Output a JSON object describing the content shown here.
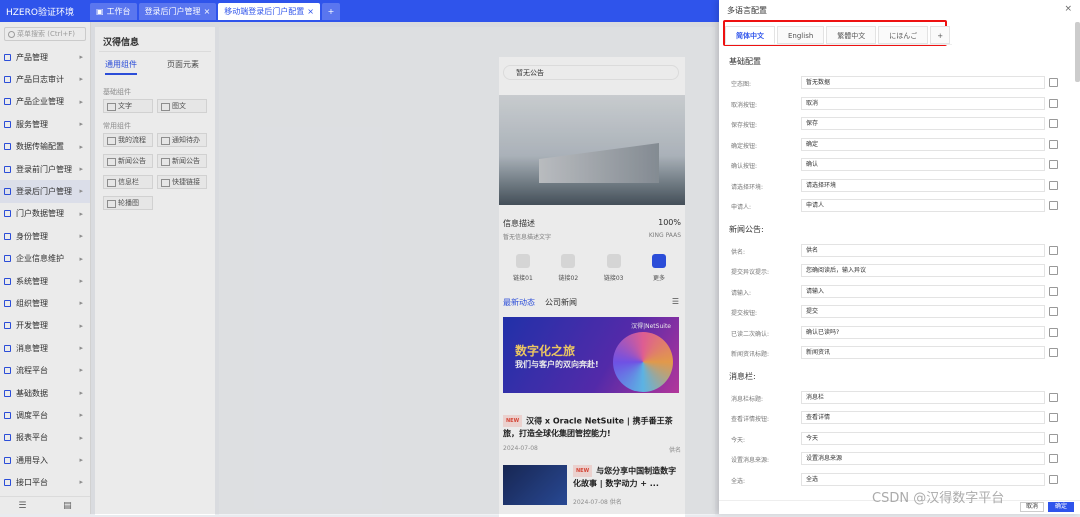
{
  "app": {
    "title": "HZERO验证环境"
  },
  "tabs": [
    {
      "label": "工作台",
      "active": false,
      "closable": false
    },
    {
      "label": "登录后门户管理",
      "active": false,
      "closable": true
    },
    {
      "label": "移动端登录后门户配置",
      "active": true,
      "closable": true
    }
  ],
  "sidebar": {
    "search_placeholder": "菜单搜索 (Ctrl+F)",
    "items": [
      {
        "label": "产品管理"
      },
      {
        "label": "产品日志审计"
      },
      {
        "label": "产品企业管理"
      },
      {
        "label": "服务管理"
      },
      {
        "label": "数据传输配置"
      },
      {
        "label": "登录前门户管理"
      },
      {
        "label": "登录后门户管理",
        "active": true
      },
      {
        "label": "门户数据管理"
      },
      {
        "label": "身份管理"
      },
      {
        "label": "企业信息维护"
      },
      {
        "label": "系统管理"
      },
      {
        "label": "组织管理"
      },
      {
        "label": "开发管理"
      },
      {
        "label": "消息管理"
      },
      {
        "label": "流程平台"
      },
      {
        "label": "基础数据"
      },
      {
        "label": "调度平台"
      },
      {
        "label": "报表平台"
      },
      {
        "label": "通用导入"
      },
      {
        "label": "接口平台"
      }
    ]
  },
  "editor": {
    "title": "汉得信息",
    "tabs": [
      {
        "label": "通用组件",
        "active": true
      },
      {
        "label": "页面元素",
        "active": false
      }
    ],
    "group_basic": "基础组件",
    "basic": [
      {
        "label": "文字"
      },
      {
        "label": "图文"
      }
    ],
    "group_common": "常用组件",
    "common": [
      {
        "label": "我的流程"
      },
      {
        "label": "通知待办"
      },
      {
        "label": "新闻公告"
      },
      {
        "label": "新闻公告"
      },
      {
        "label": "信息栏"
      },
      {
        "label": "快捷链接"
      },
      {
        "label": "轮播图"
      }
    ]
  },
  "preview": {
    "notice": "暂无公告",
    "info_title": "信息描述",
    "info_pct": "100%",
    "info_sub": "暂无信息描述文字",
    "info_brand": "KING PAAS",
    "links": [
      {
        "label": "链接01"
      },
      {
        "label": "链接02"
      },
      {
        "label": "链接03"
      },
      {
        "label": "更多"
      }
    ],
    "news_tabs": [
      {
        "label": "最新动态",
        "active": true
      },
      {
        "label": "公司新闻",
        "active": false
      }
    ],
    "promo_line1": "数字化之旅",
    "promo_line2": "我们与客户的双向奔赴!",
    "promo_logo": "汉得|NetSuite",
    "badge": "NEW",
    "news1_title": "汉得 x Oracle NetSuite | 携手番王茶旅，打造全球化集团管控能力!",
    "news1_date": "2024-07-08",
    "news1_author": "供名",
    "news2_title": "与您分享中国制造数字化故事 | 数字动力 + ...",
    "news2_date": "2024-07-08",
    "news2_author": "供名"
  },
  "drawer": {
    "title": "多语言配置",
    "close": "×",
    "lang_tabs": [
      {
        "label": "简体中文",
        "active": true
      },
      {
        "label": "English"
      },
      {
        "label": "繁體中文"
      },
      {
        "label": "にほんご"
      }
    ],
    "sections": [
      {
        "title": "基础配置",
        "rows": [
          {
            "label": "空态图:",
            "value": "暂无数据"
          },
          {
            "label": "取消按钮:",
            "value": "取消"
          },
          {
            "label": "保存按钮:",
            "value": "保存"
          },
          {
            "label": "确定按钮:",
            "value": "确定"
          },
          {
            "label": "确认按钮:",
            "value": "确认"
          },
          {
            "label": "请选择环境:",
            "value": "请选择环境"
          },
          {
            "label": "申请人:",
            "value": "申请人"
          }
        ]
      },
      {
        "title": "新闻公告:",
        "rows": [
          {
            "label": "供名:",
            "value": "供名"
          },
          {
            "label": "提交异议提示:",
            "value": "您确阅读后，输入异议"
          },
          {
            "label": "请输入:",
            "value": "请输入"
          },
          {
            "label": "提交按钮:",
            "value": "提交"
          },
          {
            "label": "已读二次确认:",
            "value": "确认已读吗?"
          },
          {
            "label": "新闻资讯标题:",
            "value": "新闻资讯"
          }
        ]
      },
      {
        "title": "消息栏:",
        "rows": [
          {
            "label": "消息栏标题:",
            "value": "消息栏"
          },
          {
            "label": "查看详情按钮:",
            "value": "查看详情"
          },
          {
            "label": "今天:",
            "value": "今天"
          },
          {
            "label": "设置消息来源:",
            "value": "设置消息来源"
          },
          {
            "label": "全选:",
            "value": "全选"
          }
        ]
      }
    ],
    "cancel": "取消",
    "ok": "确定"
  },
  "watermark": "CSDN @汉得数字平台",
  "colors": {
    "primary": "#2f54eb",
    "highlight": "#e11111"
  }
}
